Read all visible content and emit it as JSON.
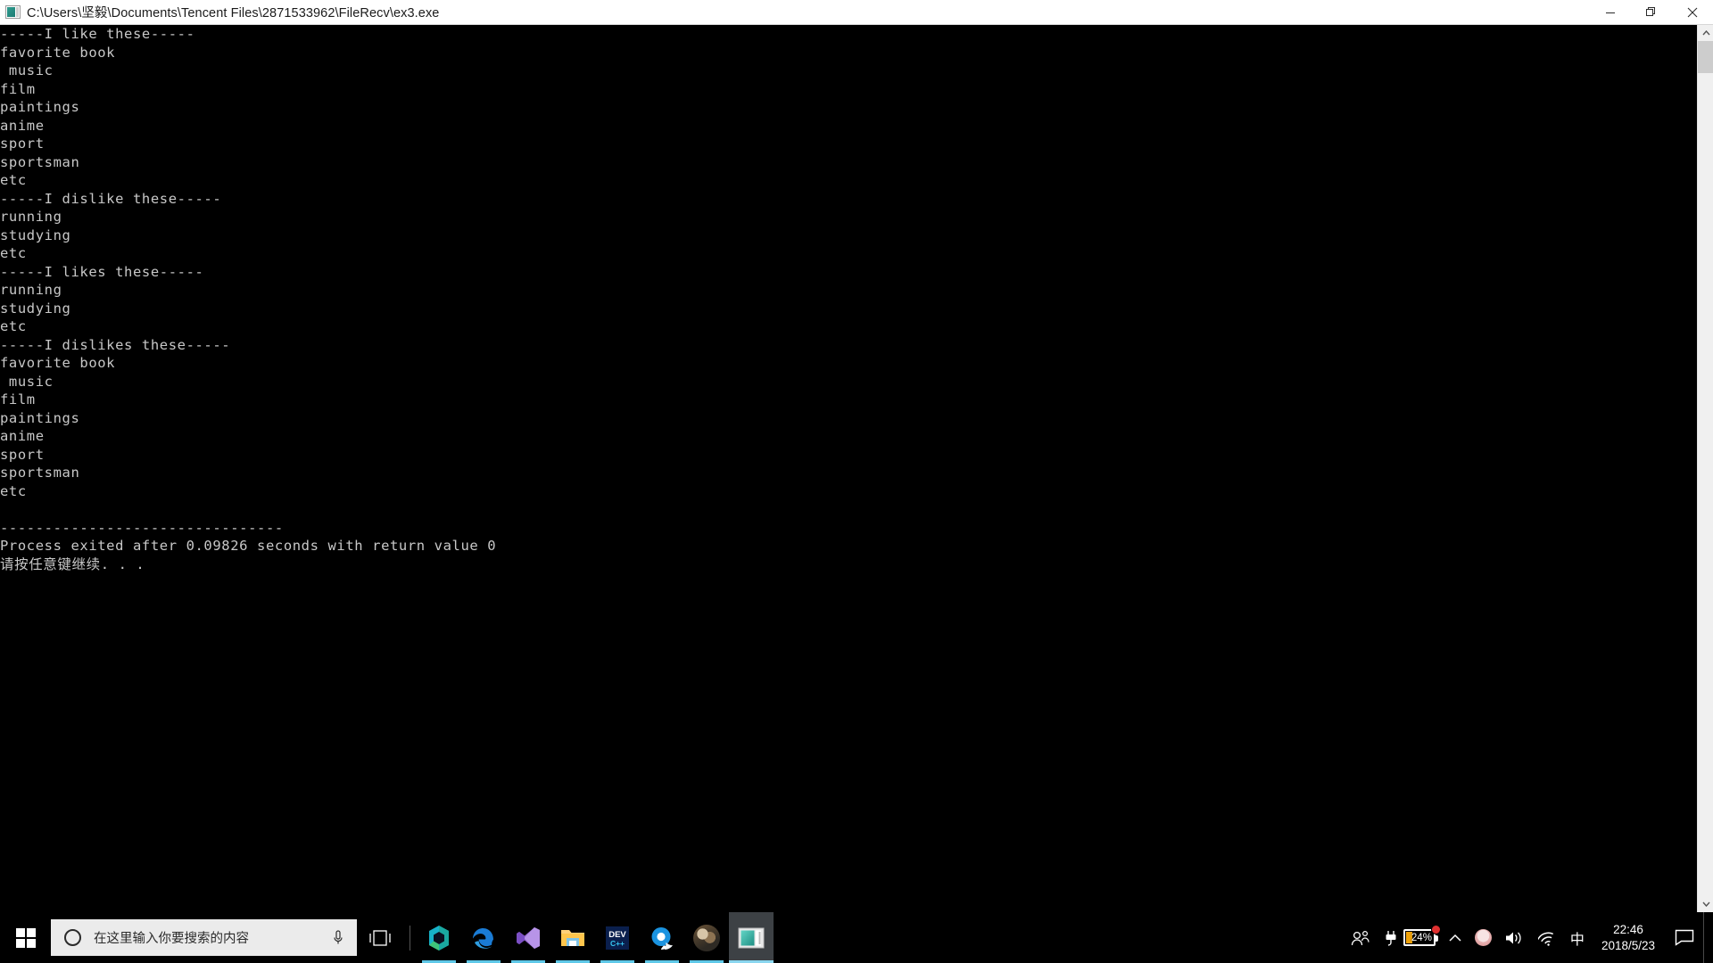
{
  "window": {
    "title": "C:\\Users\\坚毅\\Documents\\Tencent Files\\2871533962\\FileRecv\\ex3.exe",
    "icon": "console-window-icon",
    "minimize_label": "—",
    "restore_label": "❐",
    "close_label": "✕"
  },
  "console": {
    "background": "#000000",
    "foreground": "#c8c8c8",
    "lines": [
      "-----I like these-----",
      "favorite book",
      " music",
      "film",
      "paintings",
      "anime",
      "sport",
      "sportsman",
      "etc",
      "-----I dislike these-----",
      "running",
      "studying",
      "etc",
      "-----I likes these-----",
      "running",
      "studying",
      "etc",
      "-----I dislikes these-----",
      "favorite book",
      " music",
      "film",
      "paintings",
      "anime",
      "sport",
      "sportsman",
      "etc",
      "",
      "--------------------------------",
      "Process exited after 0.09826 seconds with return value 0",
      "请按任意键继续. . ."
    ],
    "text": "-----I like these-----\nfavorite book\n music\nfilm\npaintings\nanime\nsport\nsportsman\netc\n-----I dislike these-----\nrunning\nstudying\netc\n-----I likes these-----\nrunning\nstudying\netc\n-----I dislikes these-----\nfavorite book\n music\nfilm\npaintings\nanime\nsport\nsportsman\netc\n\n--------------------------------\nProcess exited after 0.09826 seconds with return value 0\n请按任意键继续. . ."
  },
  "scrollbar": {
    "up_arrow": "▲",
    "down_arrow": "▼",
    "thumb_position_pct": 0
  },
  "taskbar": {
    "start": "start-button",
    "search": {
      "placeholder": "在这里输入你要搜索的内容",
      "icon": "cortana-circle-icon",
      "mic": "microphone-icon"
    },
    "task_view": "task-view-icon",
    "apps": [
      {
        "name": "unknown-teal-app",
        "label": "",
        "state": "running"
      },
      {
        "name": "microsoft-edge",
        "label": "e",
        "state": "running"
      },
      {
        "name": "visual-studio",
        "label": "",
        "state": "running"
      },
      {
        "name": "file-explorer",
        "label": "",
        "state": "running"
      },
      {
        "name": "dev-cpp",
        "label": "DEV",
        "sub": "C++",
        "state": "running"
      },
      {
        "name": "qq-browser",
        "label": "",
        "state": "running"
      },
      {
        "name": "photo-viewer",
        "label": "",
        "state": "running"
      },
      {
        "name": "console-window",
        "label": "",
        "state": "active"
      }
    ],
    "tray": {
      "people_icon": "people-icon",
      "battery": {
        "percent": "24%",
        "charging": true,
        "badge": true
      },
      "chevron": "chevron-up-icon",
      "user_avatar": "tray-avatar-icon",
      "volume": "speaker-icon",
      "network": "wifi-icon",
      "ime": "中",
      "time": "22:46",
      "date": "2018/5/23",
      "action_center": "notification-icon",
      "show_desktop": "show-desktop-button"
    }
  }
}
